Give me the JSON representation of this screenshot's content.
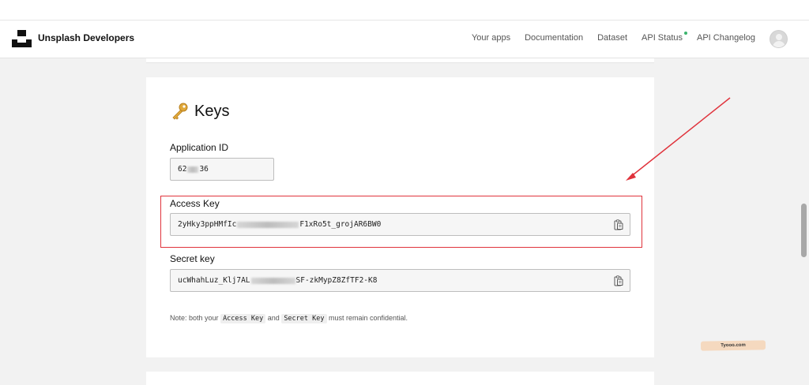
{
  "nav": {
    "brand": "Unsplash Developers",
    "links": [
      "Your apps",
      "Documentation",
      "Dataset",
      "API Status",
      "API Changelog"
    ],
    "status_dot_color": "#3cb46e"
  },
  "keys": {
    "heading": "Keys",
    "app_id": {
      "label": "Application ID",
      "prefix": "62",
      "suffix": "36"
    },
    "access": {
      "label": "Access Key",
      "prefix": "2yHky3ppHMfIc",
      "suffix": "F1xRo5t_grojAR6BW0"
    },
    "secret": {
      "label": "Secret key",
      "prefix": "ucWhahLuz_Klj7AL",
      "suffix": "SF-zkMypZ8ZfTF2-K8"
    },
    "note": {
      "pre": "Note: both your",
      "code1": "Access Key",
      "mid": "and",
      "code2": "Secret Key",
      "post": "must remain confidential."
    }
  },
  "annotation": {
    "color": "#e0333c"
  },
  "watermark": "Tyooo.com",
  "icons": [
    "unsplash-logo",
    "key-icon",
    "copy-icon",
    "avatar-icon"
  ]
}
